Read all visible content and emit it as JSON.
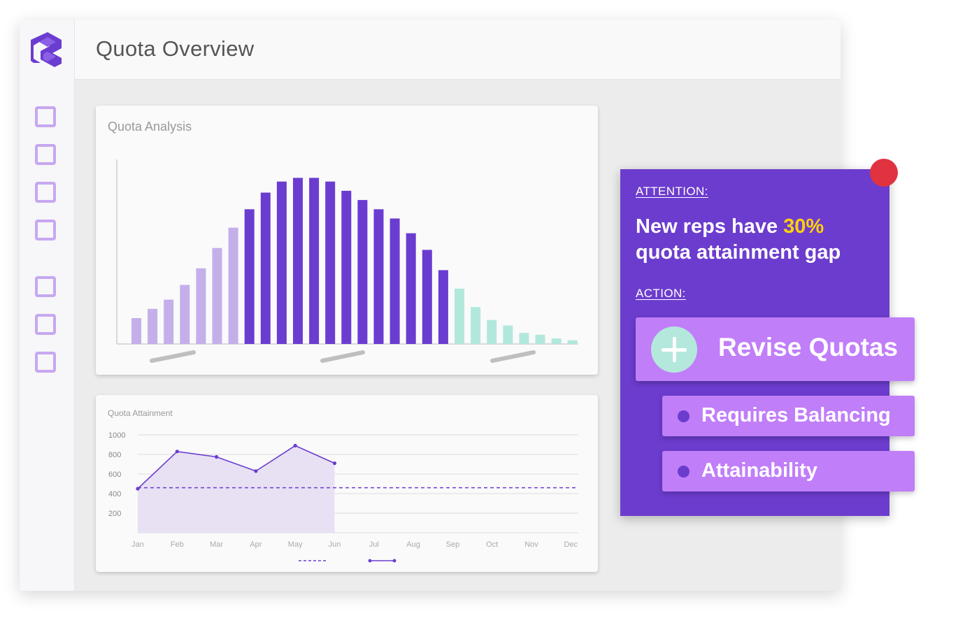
{
  "page": {
    "title": "Quota Overview",
    "logo_icon": "brand-logo-icon"
  },
  "sidebar": {
    "items": [
      {
        "icon": "square-icon"
      },
      {
        "icon": "square-icon"
      },
      {
        "icon": "square-icon"
      },
      {
        "icon": "square-icon"
      },
      {
        "icon": "square-icon"
      },
      {
        "icon": "square-icon"
      },
      {
        "icon": "square-icon"
      }
    ],
    "item_color": "#c6a8ef"
  },
  "chart_data": [
    {
      "type": "bar",
      "title": "Quota Analysis",
      "values": [
        14,
        19,
        24,
        32,
        41,
        52,
        63,
        73,
        82,
        88,
        90,
        90,
        88,
        83,
        78,
        73,
        68,
        60,
        51,
        40,
        30,
        20,
        13,
        10,
        6,
        5,
        3,
        2
      ],
      "segment_colors": [
        "#c4afeb",
        "#c4afeb",
        "#c4afeb",
        "#c4afeb",
        "#c4afeb",
        "#c4afeb",
        "#c4afeb",
        "#6b3cd0",
        "#6b3cd0",
        "#6b3cd0",
        "#6b3cd0",
        "#6b3cd0",
        "#6b3cd0",
        "#6b3cd0",
        "#6b3cd0",
        "#6b3cd0",
        "#6b3cd0",
        "#6b3cd0",
        "#6b3cd0",
        "#6b3cd0",
        "#b2e8dc",
        "#b2e8dc",
        "#b2e8dc",
        "#b2e8dc",
        "#b2e8dc",
        "#b2e8dc",
        "#b2e8dc",
        "#b2e8dc"
      ],
      "ylim": [
        0,
        100
      ],
      "grid": false
    },
    {
      "type": "area",
      "title": "Quota Attainment",
      "categories": [
        "Jan",
        "Feb",
        "Mar",
        "Apr",
        "May",
        "Jun",
        "Jul",
        "Aug",
        "Sep",
        "Oct",
        "Nov",
        "Dec"
      ],
      "yticks": [
        200,
        400,
        600,
        800,
        1000
      ],
      "ylim": [
        0,
        1000
      ],
      "series": [
        {
          "style": "solid-line-with-markers",
          "color": "#6b3cd0",
          "values": [
            450,
            830,
            775,
            630,
            890,
            710
          ]
        },
        {
          "style": "dashed",
          "color": "#6b3cd0",
          "values": [
            460,
            460,
            460,
            460,
            460,
            460,
            460,
            460,
            460,
            460,
            460,
            460
          ]
        }
      ],
      "grid": true,
      "legend_placement": "bottom"
    }
  ],
  "attention": {
    "label": "ATTENTION:",
    "headline_prefix": "New reps have ",
    "headline_highlight": "30%",
    "headline_suffix": " quota attainment gap",
    "action_label": "ACTION:",
    "primary_action": {
      "label": "Revise Quotas",
      "icon": "plus-icon"
    },
    "sub_actions": [
      {
        "label": "Requires Balancing",
        "icon": "bullet-icon"
      },
      {
        "label": "Attainability",
        "icon": "bullet-icon"
      }
    ],
    "notification_color": "#e0323f",
    "panel_color": "#6c3cce",
    "highlight_color": "#ffd10a"
  }
}
